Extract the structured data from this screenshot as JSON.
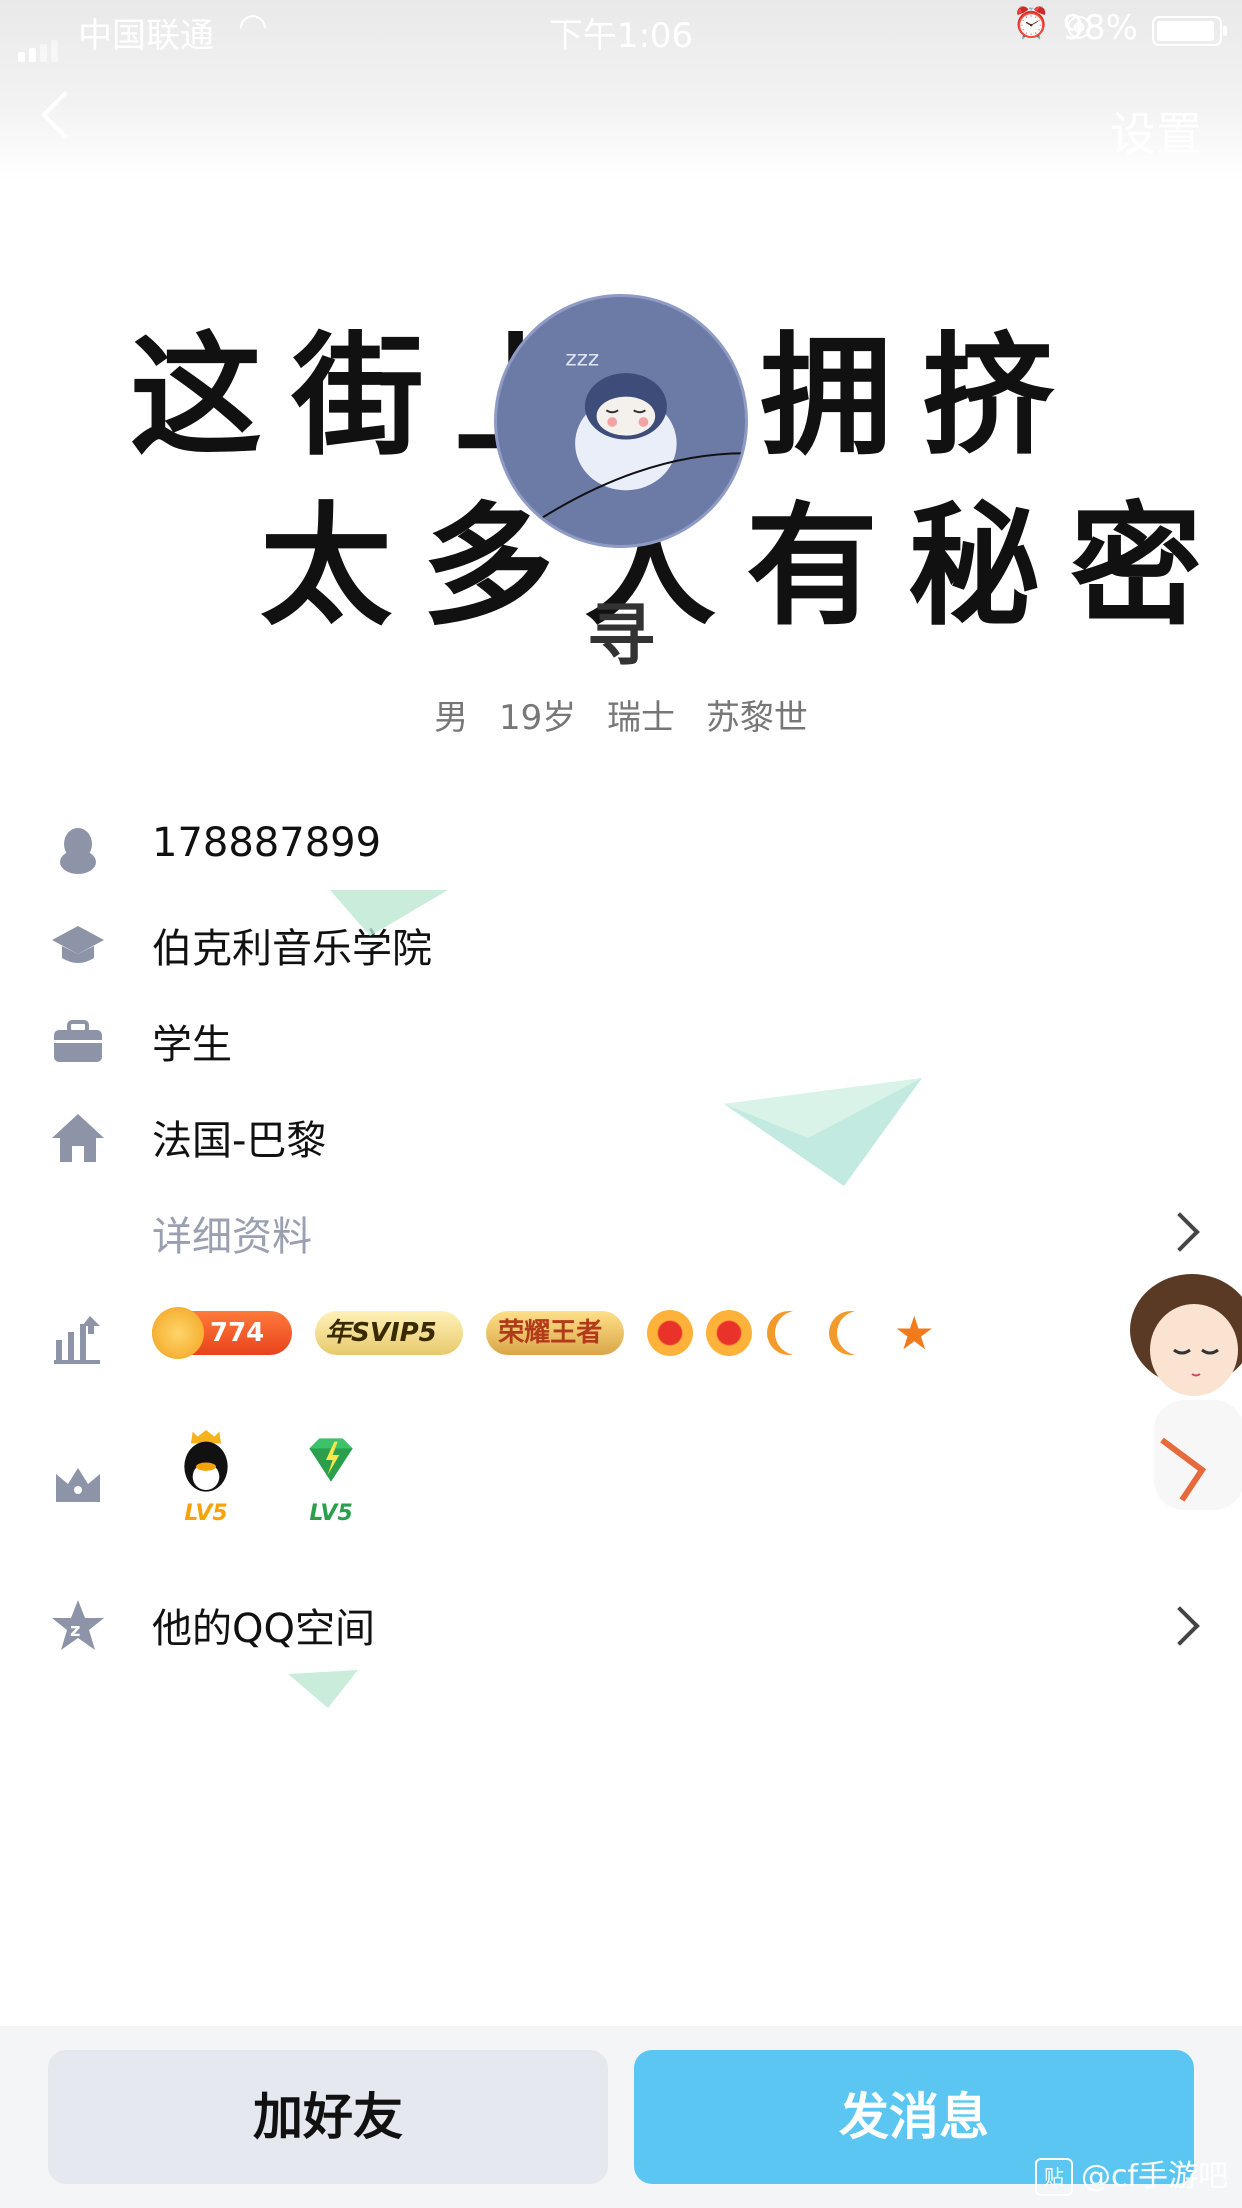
{
  "status_bar": {
    "carrier": "中国联通",
    "time": "下午1:06",
    "battery": "98%"
  },
  "nav": {
    "settings": "设置"
  },
  "cover": {
    "line1": "这街上",
    "line1b": "拥挤",
    "line2": "太多人有秘密",
    "nickname": "寻"
  },
  "basic_info": {
    "gender": "男",
    "age": "19岁",
    "country": "瑞士",
    "city": "苏黎世"
  },
  "info": {
    "qq_number": "178887899",
    "school": "伯克利音乐学院",
    "occupation": "学生",
    "hometown": "法国-巴黎",
    "details_link": "详细资料"
  },
  "badges": {
    "coin_value": "774",
    "svip": "年SVIP5",
    "king": "荣耀王者"
  },
  "levels": {
    "qq_level": "LV5",
    "diamond_level": "LV5"
  },
  "qzone": {
    "label": "他的QQ空间"
  },
  "actions": {
    "add_friend": "加好友",
    "send_message": "发消息"
  },
  "watermark": {
    "text": "@cf手游吧",
    "logo": "贴"
  },
  "colors": {
    "accent": "#5cc6f2",
    "icon_gray": "#8e94a8"
  }
}
